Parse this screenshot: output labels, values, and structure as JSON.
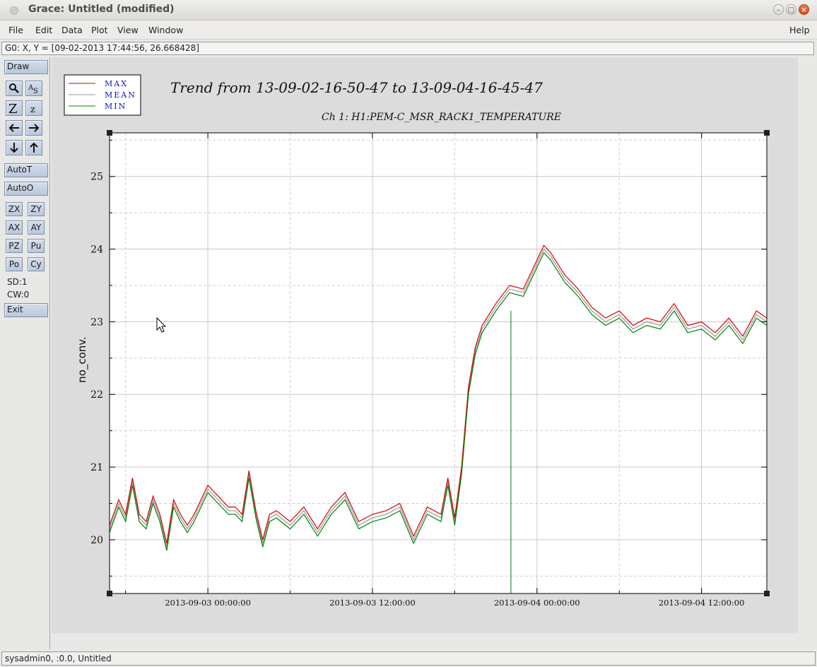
{
  "window": {
    "title": "Grace: Untitled (modified)"
  },
  "menu": {
    "file": "File",
    "edit": "Edit",
    "data": "Data",
    "plot": "Plot",
    "view": "View",
    "window": "Window",
    "help": "Help"
  },
  "locator": "G0: X, Y = [09-02-2013 17:44:56, 26.668428]",
  "toolbar": {
    "draw": "Draw",
    "autot": "AutoT",
    "autoo": "AutoO",
    "zx": "ZX",
    "zy": "ZY",
    "ax": "AX",
    "ay": "AY",
    "pz": "PZ",
    "pu": "Pu",
    "po": "Po",
    "cy": "Cy",
    "sd": "SD:1",
    "cw": "CW:0",
    "exit": "Exit",
    "icons": [
      "zoom-icon",
      "autoscale-text-icon",
      "zoom-in-icon",
      "zoom-out-icon",
      "arrow-left-icon",
      "arrow-right-icon",
      "arrow-down-icon",
      "arrow-up-icon"
    ]
  },
  "status_bar": "sysadmin0, :0.0, Untitled",
  "colors": {
    "max": "#d40000",
    "mean": "#9a9a9a",
    "min": "#008000",
    "button_bg": "#c5d3e3"
  },
  "chart_data": {
    "type": "line",
    "title": "Trend from 13-09-02-16-50-47 to 13-09-04-16-45-47",
    "subtitle": "Ch 1: H1:PEM-C_MSR_RACK1_TEMPERATURE",
    "xlabel": "",
    "ylabel": "no_conv.",
    "xlim_hours": [
      -7.17,
      40.76
    ],
    "ylim": [
      19.26,
      25.6
    ],
    "x_ticks": [
      "2013-09-03 00:00:00",
      "2013-09-03 12:00:00",
      "2013-09-04 00:00:00",
      "2013-09-04 12:00:00"
    ],
    "y_ticks": [
      "20",
      "21",
      "22",
      "23",
      "24",
      "25"
    ],
    "grid": true,
    "legend_position": "top-left",
    "legend": [
      "MAX",
      "MEAN",
      "MIN"
    ],
    "x_hours": [
      -7.17,
      -6.5,
      -6.0,
      -5.5,
      -5.0,
      -4.5,
      -4.0,
      -3.5,
      -3.0,
      -2.5,
      -2.0,
      -1.5,
      -1.0,
      0.0,
      1.0,
      1.5,
      2.0,
      2.5,
      3.0,
      3.5,
      4.0,
      4.5,
      5.0,
      6.0,
      7.0,
      8.0,
      9.0,
      10.0,
      11.0,
      12.0,
      13.0,
      14.0,
      15.0,
      16.0,
      17.0,
      17.5,
      18.0,
      18.5,
      19.0,
      19.5,
      20.0,
      21.0,
      22.0,
      23.0,
      24.0,
      24.5,
      25.0,
      26.0,
      27.0,
      28.0,
      29.0,
      30.0,
      31.0,
      32.0,
      33.0,
      34.0,
      35.0,
      36.0,
      37.0,
      38.0,
      39.0,
      40.0,
      40.76
    ],
    "series": [
      {
        "name": "MAX",
        "values": [
          20.2,
          20.55,
          20.35,
          20.85,
          20.35,
          20.25,
          20.6,
          20.35,
          19.95,
          20.55,
          20.35,
          20.2,
          20.35,
          20.75,
          20.55,
          20.45,
          20.45,
          20.35,
          20.95,
          20.4,
          20.0,
          20.35,
          20.4,
          20.25,
          20.45,
          20.15,
          20.45,
          20.65,
          20.25,
          20.35,
          20.4,
          20.5,
          20.05,
          20.45,
          20.35,
          20.85,
          20.3,
          21.0,
          22.1,
          22.65,
          22.95,
          23.25,
          23.5,
          23.45,
          23.85,
          24.05,
          23.95,
          23.65,
          23.45,
          23.2,
          23.05,
          23.15,
          22.95,
          23.05,
          23.0,
          23.25,
          22.95,
          23.0,
          22.85,
          23.05,
          22.8,
          23.15,
          23.05
        ]
      },
      {
        "name": "MEAN",
        "values": [
          20.15,
          20.5,
          20.3,
          20.8,
          20.3,
          20.2,
          20.55,
          20.3,
          19.9,
          20.5,
          20.3,
          20.15,
          20.3,
          20.7,
          20.5,
          20.4,
          20.4,
          20.3,
          20.9,
          20.35,
          19.95,
          20.3,
          20.35,
          20.2,
          20.4,
          20.1,
          20.4,
          20.6,
          20.2,
          20.3,
          20.35,
          20.45,
          20.0,
          20.4,
          20.3,
          20.8,
          20.25,
          20.95,
          22.05,
          22.6,
          22.9,
          23.2,
          23.45,
          23.4,
          23.8,
          24.0,
          23.9,
          23.6,
          23.4,
          23.15,
          23.0,
          23.1,
          22.9,
          23.0,
          22.95,
          23.2,
          22.9,
          22.95,
          22.8,
          23.0,
          22.75,
          23.1,
          23.0
        ]
      },
      {
        "name": "MIN",
        "values": [
          20.1,
          20.45,
          20.25,
          20.75,
          20.25,
          20.15,
          20.5,
          20.25,
          19.85,
          20.45,
          20.25,
          20.1,
          20.25,
          20.65,
          20.45,
          20.35,
          20.35,
          20.25,
          20.85,
          20.3,
          19.9,
          20.25,
          20.3,
          20.15,
          20.35,
          20.05,
          20.35,
          20.55,
          20.15,
          20.25,
          20.3,
          20.4,
          19.95,
          20.35,
          20.25,
          20.75,
          20.2,
          20.9,
          22.0,
          22.55,
          22.85,
          23.15,
          23.4,
          23.35,
          23.75,
          23.95,
          23.85,
          23.55,
          23.35,
          23.1,
          22.95,
          23.05,
          22.85,
          22.95,
          22.9,
          23.15,
          22.85,
          22.9,
          22.75,
          22.95,
          22.7,
          23.05,
          22.95
        ]
      }
    ]
  }
}
